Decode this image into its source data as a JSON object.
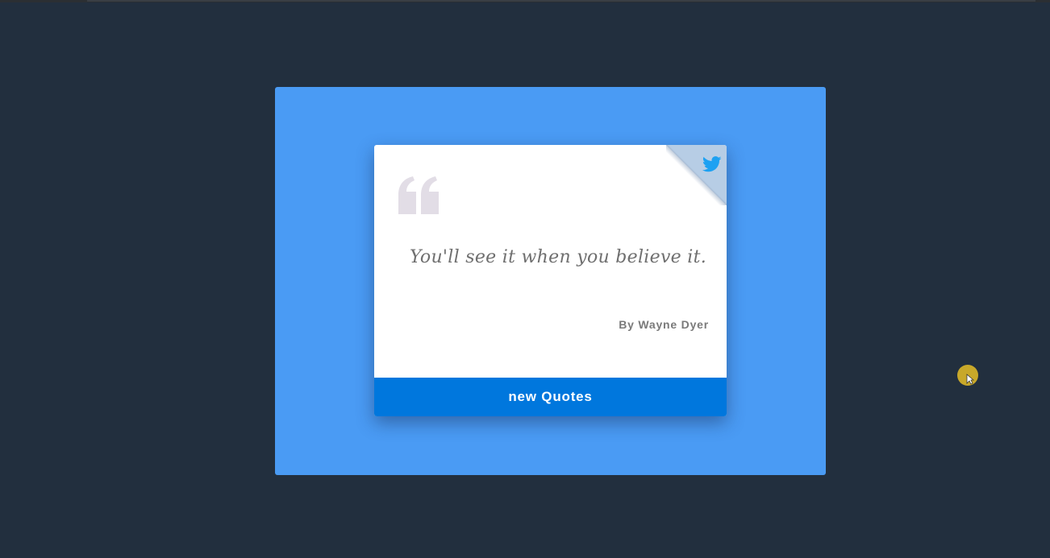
{
  "quote": {
    "text": "You'll see it when you believe it.",
    "author": "By Wayne Dyer"
  },
  "actions": {
    "new_quote_label": "new Quotes",
    "tweet_icon": "twitter-icon"
  },
  "colors": {
    "page_background": "#222f3e",
    "stage_background": "#4a9bf4",
    "card_background": "#ffffff",
    "button_background": "#0077dd",
    "twitter_blue": "#1da1f2",
    "corner_fold": "#b7cde5",
    "quote_mark": "#e2dde6"
  }
}
